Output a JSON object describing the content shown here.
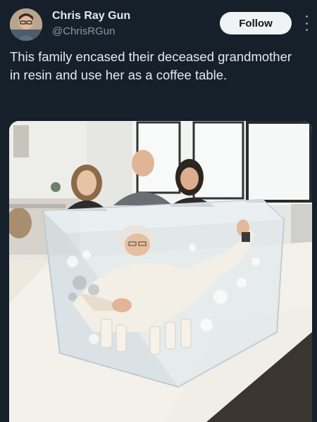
{
  "author": {
    "name": "Chris Ray Gun",
    "handle": "@ChrisRGun",
    "avatar_icon": "avatar-photo"
  },
  "actions": {
    "follow_label": "Follow",
    "more_icon": "more-vertical-icon"
  },
  "tweet": {
    "text": "This family encased their deceased grandmother in resin and use her as a coffee table."
  },
  "colors": {
    "background": "#15202b",
    "text": "#e7e9ea",
    "secondary": "#8b98a5",
    "follow_bg": "#eff3f4"
  }
}
